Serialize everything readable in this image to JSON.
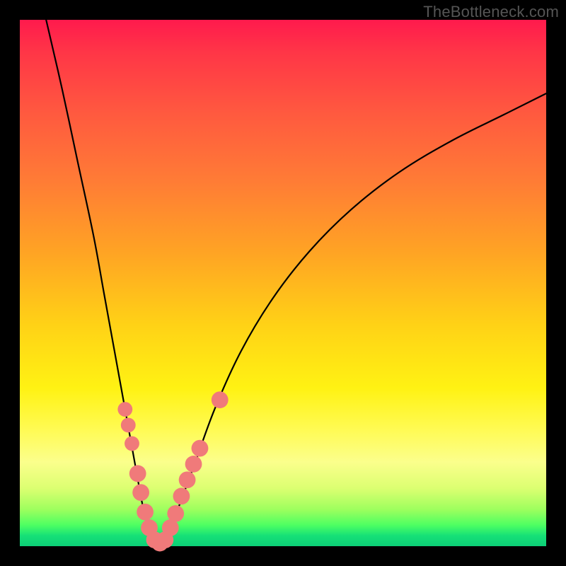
{
  "watermark": "TheBottleneck.com",
  "gradient_colors": {
    "top": "#ff1a4d",
    "mid_upper": "#ff7a36",
    "mid": "#ffd216",
    "mid_lower": "#fffb55",
    "bottom": "#0ccf77"
  },
  "chart_data": {
    "type": "line",
    "title": "",
    "xlabel": "",
    "ylabel": "",
    "xlim": [
      0,
      100
    ],
    "ylim": [
      0,
      100
    ],
    "grid": false,
    "series": [
      {
        "name": "bottleneck-curve",
        "x": [
          5,
          8,
          11,
          14,
          16,
          18,
          20,
          22,
          23.5,
          25,
          26.5,
          28,
          30,
          33,
          37,
          42,
          48,
          55,
          63,
          72,
          82,
          92,
          100
        ],
        "y": [
          100,
          87,
          73,
          59,
          48,
          37,
          26,
          15,
          7,
          2,
          0.5,
          2,
          7,
          15,
          26,
          37,
          47,
          56,
          64,
          71,
          77,
          82,
          86
        ]
      }
    ],
    "markers": {
      "name": "highlighted-points",
      "color": "#f07a7a",
      "points": [
        {
          "x": 20.0,
          "y": 26.0,
          "r": 1.4
        },
        {
          "x": 20.6,
          "y": 23.0,
          "r": 1.4
        },
        {
          "x": 21.3,
          "y": 19.5,
          "r": 1.4
        },
        {
          "x": 22.4,
          "y": 13.8,
          "r": 1.6
        },
        {
          "x": 23.0,
          "y": 10.2,
          "r": 1.6
        },
        {
          "x": 23.8,
          "y": 6.5,
          "r": 1.6
        },
        {
          "x": 24.6,
          "y": 3.5,
          "r": 1.6
        },
        {
          "x": 25.6,
          "y": 1.2,
          "r": 1.6
        },
        {
          "x": 26.6,
          "y": 0.6,
          "r": 1.6
        },
        {
          "x": 27.6,
          "y": 1.2,
          "r": 1.6
        },
        {
          "x": 28.6,
          "y": 3.5,
          "r": 1.6
        },
        {
          "x": 29.6,
          "y": 6.2,
          "r": 1.6
        },
        {
          "x": 30.7,
          "y": 9.5,
          "r": 1.6
        },
        {
          "x": 31.8,
          "y": 12.6,
          "r": 1.6
        },
        {
          "x": 33.0,
          "y": 15.6,
          "r": 1.6
        },
        {
          "x": 34.2,
          "y": 18.6,
          "r": 1.6
        },
        {
          "x": 38.0,
          "y": 27.8,
          "r": 1.6
        }
      ]
    }
  }
}
